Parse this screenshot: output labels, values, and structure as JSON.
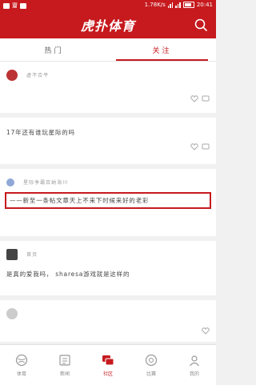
{
  "status_bar": {
    "left_text": "齏",
    "speed": "1.78K/s",
    "time": "20:41"
  },
  "header": {
    "logo": "虎扑体育"
  },
  "tabs": [
    {
      "label": "热门",
      "active": false
    },
    {
      "label": "关注",
      "active": true
    }
  ],
  "posts": [
    {
      "user": "虚不合平",
      "likes": "",
      "comments": "",
      "content": ""
    },
    {
      "user": "",
      "likes": "",
      "comments": "",
      "content": "17年还有谁玩星际的吗"
    },
    {
      "user": "星际争霸百纳海川",
      "likes": "",
      "comments": "",
      "content": "——新至一条帖文章天上不来下时候来好的老彩"
    },
    {
      "user": "首页",
      "likes": "",
      "comments": "",
      "content": "是真的爱我吗， sharesa游戏就是这样的"
    }
  ],
  "bottom_nav": [
    {
      "label": "体育",
      "icon": "sports-icon",
      "active": false
    },
    {
      "label": "新闻",
      "icon": "news-icon",
      "active": false
    },
    {
      "label": "社区",
      "icon": "community-icon",
      "active": true
    },
    {
      "label": "比赛",
      "icon": "match-icon",
      "active": false
    },
    {
      "label": "我的",
      "icon": "profile-icon",
      "active": false
    }
  ],
  "colors": {
    "brand": "#c61a1e"
  }
}
